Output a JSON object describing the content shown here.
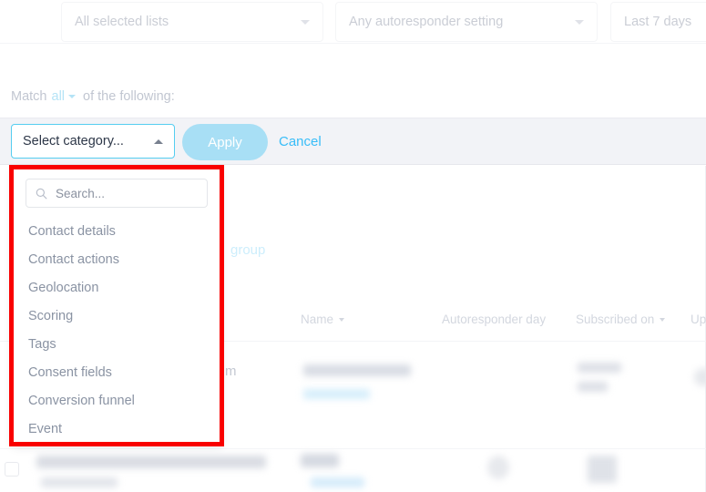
{
  "top_filters": [
    {
      "id": "all-selected-lists",
      "label": "All selected lists",
      "icon": "chevron-down-icon"
    },
    {
      "id": "any-autoresponder-setting",
      "label": "Any autoresponder setting",
      "icon": "chevron-down-icon"
    },
    {
      "id": "last-7-days",
      "label": "Last 7 days",
      "icon": "chevron-down-icon"
    }
  ],
  "match_row": {
    "prefix": "Match",
    "operator": "all",
    "suffix": "of the following:"
  },
  "action_bar": {
    "category_label": "Select category...",
    "category_icon": "chevron-up-icon",
    "apply_label": "Apply",
    "cancel_label": "Cancel"
  },
  "dropdown": {
    "search_placeholder": "Search...",
    "search_value": "",
    "search_icon": "search-icon",
    "items": [
      {
        "label": "Contact details"
      },
      {
        "label": "Contact actions"
      },
      {
        "label": "Geolocation"
      },
      {
        "label": "Scoring"
      },
      {
        "label": "Tags"
      },
      {
        "label": "Consent fields"
      },
      {
        "label": "Conversion funnel"
      },
      {
        "label": "Event"
      }
    ]
  },
  "background": {
    "group_link": "group",
    "partial_text": "m",
    "table_headers": [
      {
        "label": "Name",
        "sortable": true
      },
      {
        "label": "Autoresponder day",
        "sortable": false
      },
      {
        "label": "Subscribed on",
        "sortable": true
      },
      {
        "label": "Upd",
        "sortable": false
      }
    ]
  },
  "colors": {
    "accent_cyan": "#55cdf0",
    "link_blue": "#38bdf8",
    "apply_blue": "#a8dff5",
    "highlight_red": "#f90000",
    "band_gray": "#f2f3f7"
  }
}
